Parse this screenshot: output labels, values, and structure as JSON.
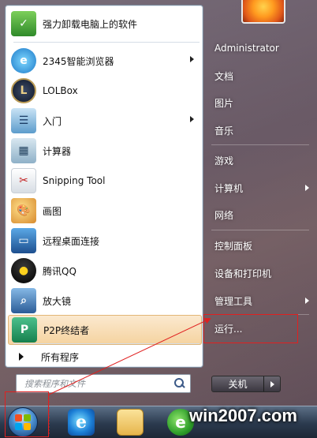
{
  "programs": [
    {
      "label": "强力卸载电脑上的软件",
      "icon": "uninstall-icon",
      "submenu": false
    },
    {
      "label": "2345智能浏览器",
      "icon": "browser-2345-icon",
      "submenu": true
    },
    {
      "label": "LOLBox",
      "icon": "lolbox-icon",
      "submenu": false
    },
    {
      "label": "入门",
      "icon": "getting-started-icon",
      "submenu": true
    },
    {
      "label": "计算器",
      "icon": "calculator-icon",
      "submenu": false
    },
    {
      "label": "Snipping Tool",
      "icon": "snipping-tool-icon",
      "submenu": false
    },
    {
      "label": "画图",
      "icon": "paint-icon",
      "submenu": false
    },
    {
      "label": "远程桌面连接",
      "icon": "remote-desktop-icon",
      "submenu": false
    },
    {
      "label": "腾讯QQ",
      "icon": "qq-icon",
      "submenu": false
    },
    {
      "label": "放大镜",
      "icon": "magnifier-icon",
      "submenu": false
    },
    {
      "label": "P2P终结者",
      "icon": "p2p-icon",
      "submenu": false,
      "highlighted": true
    }
  ],
  "all_programs": "所有程序",
  "search": {
    "placeholder": "搜索程序和文件"
  },
  "right_pane": [
    {
      "label": "Administrator",
      "submenu": false
    },
    {
      "label": "文档",
      "submenu": false
    },
    {
      "label": "图片",
      "submenu": false
    },
    {
      "label": "音乐",
      "submenu": false
    },
    {
      "label": "游戏",
      "submenu": false
    },
    {
      "label": "计算机",
      "submenu": true
    },
    {
      "label": "网络",
      "submenu": false
    },
    {
      "label": "控制面板",
      "submenu": false
    },
    {
      "label": "设备和打印机",
      "submenu": false
    },
    {
      "label": "管理工具",
      "submenu": true
    },
    {
      "label": "运行...",
      "submenu": false
    }
  ],
  "shutdown": {
    "label": "关机"
  },
  "watermark": "win2007.com",
  "colors": {
    "highlight": "#f5d3a0",
    "annotation": "#e02020"
  }
}
